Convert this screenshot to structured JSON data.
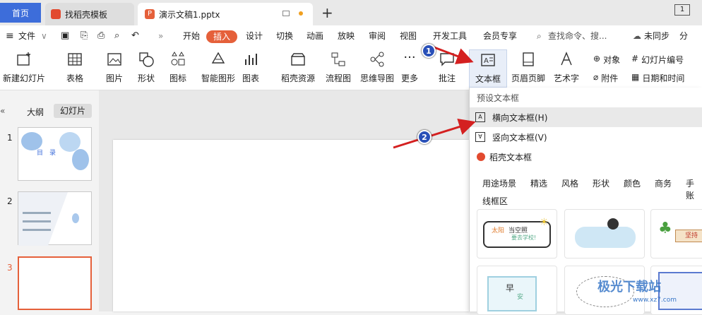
{
  "tabs": {
    "home": "首页",
    "template": "找稻壳模板",
    "doc": "演示文稿1.pptx",
    "plus": "+"
  },
  "menu": {
    "file": "文件",
    "items": [
      "开始",
      "插入",
      "设计",
      "切换",
      "动画",
      "放映",
      "审阅",
      "视图",
      "开发工具",
      "会员专享"
    ],
    "search": "查找命令、搜...",
    "sync": "未同步",
    "share": "分"
  },
  "ribbon": {
    "new_slide": "新建幻灯片",
    "table": "表格",
    "picture": "图片",
    "shape": "形状",
    "icon": "图标",
    "smart": "智能图形",
    "chart": "图表",
    "docer": "稻壳资源",
    "flow": "流程图",
    "mind": "思维导图",
    "more": "更多",
    "comment": "批注",
    "textbox": "文本框",
    "header": "页眉页脚",
    "wordart": "艺术字",
    "object": "对象",
    "slide_num": "幻灯片编号",
    "attach": "附件",
    "datetime": "日期和时间"
  },
  "panel": {
    "outline": "大纲",
    "slides": "幻灯片",
    "nums": [
      "1",
      "2",
      "3"
    ],
    "thumb1_title": "目　录"
  },
  "dropdown": {
    "preset": "预设文本框",
    "horizontal": "横向文本框(H)",
    "vertical": "竖向文本框(V)",
    "docer_box": "稻壳文本框",
    "cats": [
      "用途场景",
      "精选",
      "风格",
      "形状",
      "颜色",
      "商务",
      "手账"
    ],
    "cat2": "线框区"
  },
  "cards": {
    "c1a": "太阳",
    "c1b": "当空照",
    "c1c": "要去学校!",
    "c3": "坚持",
    "c4": "早",
    "c4b": "安"
  },
  "badges": [
    "1",
    "2"
  ],
  "watermark": {
    "text": "极光下载站",
    "url": "www.xz7.com"
  },
  "colors": {
    "accent": "#e5603a",
    "blue": "#3d6dda",
    "badge": "#2950b8",
    "arrow": "#d42020"
  }
}
